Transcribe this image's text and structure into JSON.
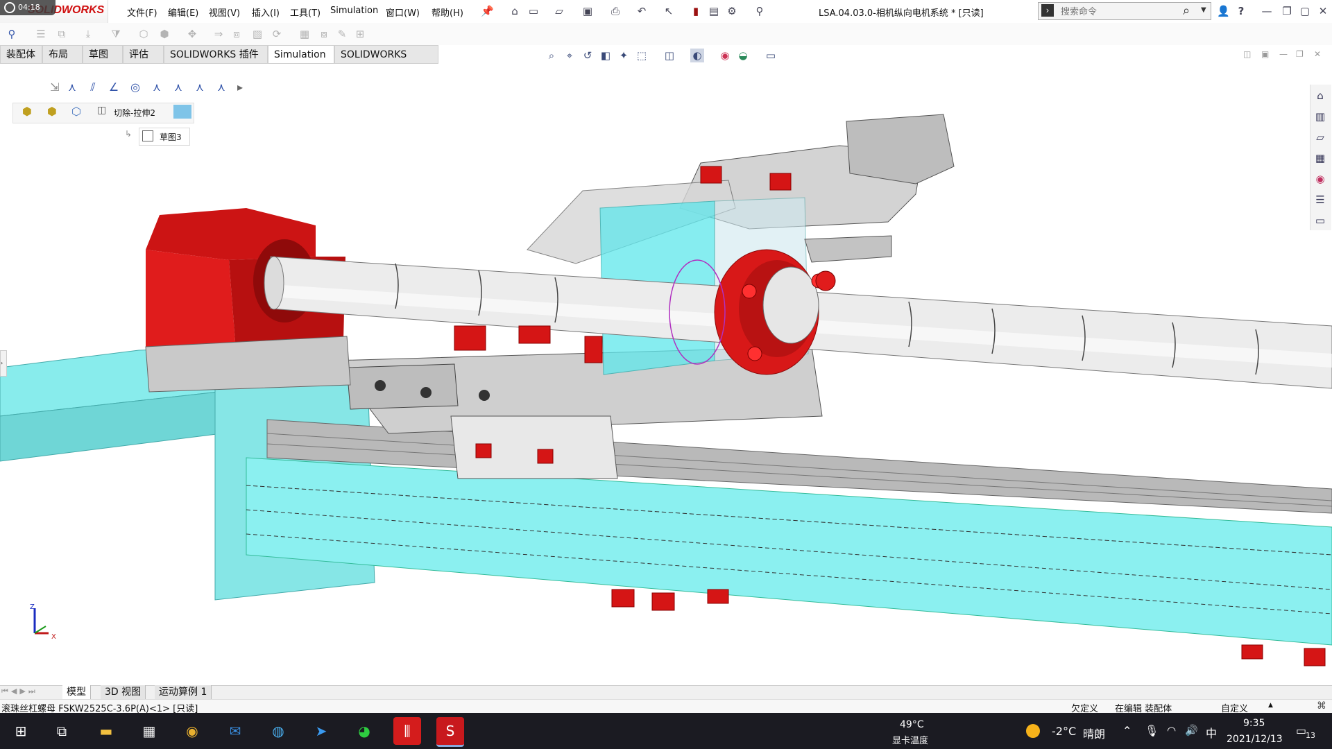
{
  "recorder_time": "04:18",
  "app": {
    "logo": "SOLIDWORKS",
    "document_title": "LSA.04.03.0-相机纵向电机系统 * [只读]"
  },
  "menu": [
    "文件(F)",
    "编辑(E)",
    "视图(V)",
    "插入(I)",
    "工具(T)",
    "Simulation",
    "窗口(W)",
    "帮助(H)"
  ],
  "search": {
    "placeholder": "搜索命令"
  },
  "tabs": [
    "装配体",
    "布局",
    "草图",
    "评估",
    "SOLIDWORKS 插件",
    "Simulation",
    "SOLIDWORKS MBD"
  ],
  "active_tab": "Simulation",
  "feature_tree": {
    "breadcrumb": "切除-拉伸2",
    "sketch": "草图3"
  },
  "triad": {
    "z": "Z",
    "x": "X"
  },
  "bottom_tabs": [
    "模型",
    "3D 视图",
    "运动算例 1"
  ],
  "status": {
    "selection": "滚珠丝杠螺母 FSKW2525C-3.6P(A)<1> [只读]",
    "defined": "欠定义",
    "editing": "在编辑 装配体",
    "units": "自定义"
  },
  "taskbar": {
    "gpu_temp": "49°C",
    "gpu_label": "显卡温度",
    "weather_temp": "-2°C",
    "weather_desc": "晴朗",
    "ime": "中",
    "time": "9:35",
    "date": "2021/12/13",
    "notifications": "13"
  },
  "colors": {
    "brand_red": "#d01010",
    "part_red": "#e31b1b",
    "part_cyan": "#7fe8e8",
    "part_gray": "#c8c8c8"
  },
  "icons": {
    "search": "search-icon",
    "help": "help-icon",
    "home": "home-icon",
    "undo": "undo-icon",
    "save": "save-icon",
    "print": "print-icon",
    "settings": "settings-icon"
  }
}
